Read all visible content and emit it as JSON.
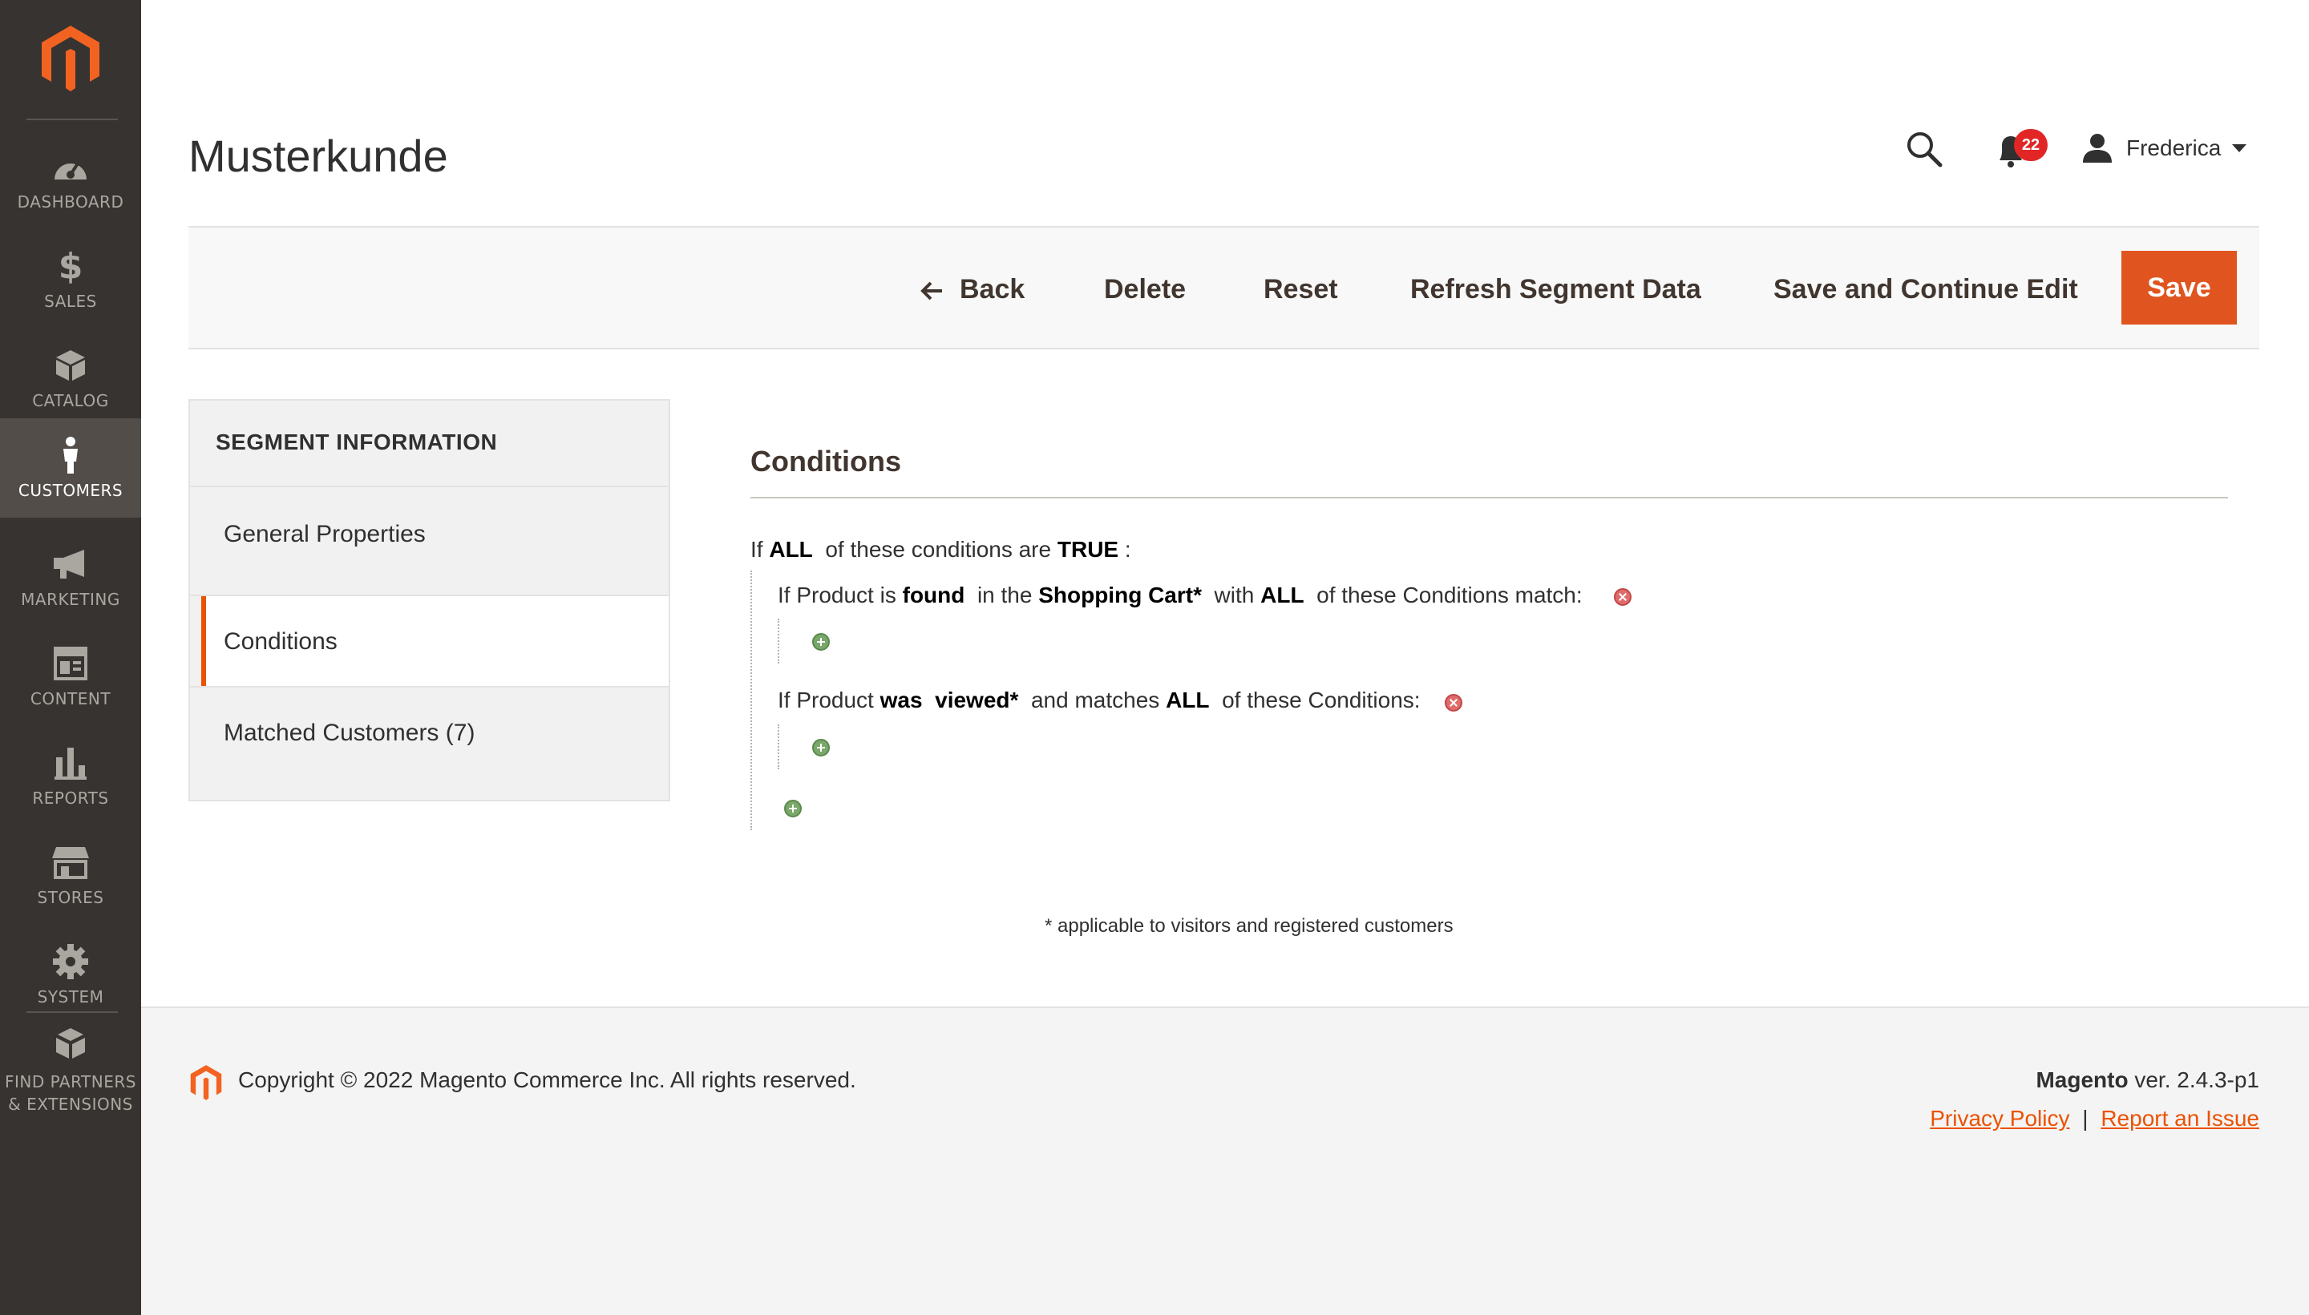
{
  "sidebar": {
    "logo": "magento-logo",
    "items": [
      {
        "label": "DASHBOARD",
        "icon": "dashboard-icon"
      },
      {
        "label": "SALES",
        "icon": "dollar-icon"
      },
      {
        "label": "CATALOG",
        "icon": "box-icon"
      },
      {
        "label": "CUSTOMERS",
        "icon": "person-icon",
        "active": true
      },
      {
        "label": "MARKETING",
        "icon": "megaphone-icon"
      },
      {
        "label": "CONTENT",
        "icon": "layout-icon"
      },
      {
        "label": "REPORTS",
        "icon": "bar-chart-icon"
      },
      {
        "label": "STORES",
        "icon": "storefront-icon"
      },
      {
        "label": "SYSTEM",
        "icon": "gear-icon"
      },
      {
        "label_line1": "FIND PARTNERS",
        "label_line2": "& EXTENSIONS",
        "icon": "cubes-icon"
      }
    ]
  },
  "header": {
    "title": "Musterkunde",
    "notifications_count": "22",
    "user_name": "Frederica"
  },
  "actions": {
    "back": "Back",
    "delete": "Delete",
    "reset": "Reset",
    "refresh": "Refresh Segment Data",
    "save_continue": "Save and Continue Edit",
    "save": "Save"
  },
  "tabs": {
    "title": "SEGMENT INFORMATION",
    "items": [
      {
        "label": "General Properties"
      },
      {
        "label": "Conditions",
        "active": true
      },
      {
        "label": "Matched Customers (7)"
      }
    ]
  },
  "conditions": {
    "title": "Conditions",
    "root": {
      "p1": "If",
      "agg": "ALL",
      "p2": "of these conditions are",
      "value": "TRUE",
      "p3": ":"
    },
    "rule1": {
      "p1": "If Product is",
      "state": "found",
      "p2": "in the",
      "where": "Shopping Cart*",
      "p3": "with",
      "agg": "ALL",
      "p4": "of these Conditions match:"
    },
    "rule2": {
      "p1": "If Product",
      "op": "was",
      "state": "viewed*",
      "p2": "and matches",
      "agg": "ALL",
      "p3": "of these Conditions:"
    },
    "footnote": "* applicable to visitors and registered customers"
  },
  "footer": {
    "copyright": "Copyright © 2022 Magento Commerce Inc. All rights reserved.",
    "brand": "Magento",
    "version": "ver. 2.4.3-p1",
    "privacy": "Privacy Policy",
    "separator": "|",
    "report": "Report an Issue"
  },
  "colors": {
    "sidebar_bg": "#373330",
    "accent": "#eb5202",
    "save_button": "#e0551f"
  }
}
